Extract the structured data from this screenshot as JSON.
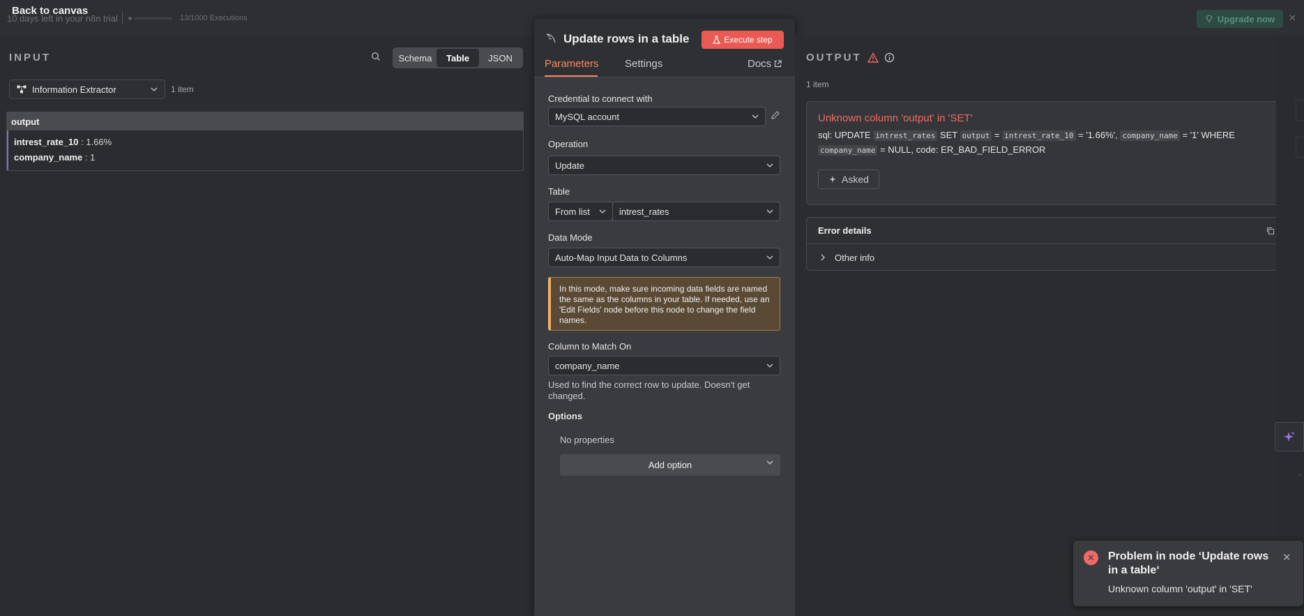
{
  "topbar": {
    "back_label": "Back to canvas",
    "trial_text": "10 days left in your n8n trial",
    "executions_text": "13/1000 Executions",
    "executions_progress": 0.013,
    "upgrade_label": "Upgrade now"
  },
  "input": {
    "title": "INPUT",
    "view_tabs": [
      "Schema",
      "Table",
      "JSON"
    ],
    "active_view": "Table",
    "node_selected": "Information Extractor",
    "items_count": "1 item",
    "table_header": "output",
    "rows": [
      {
        "key": "intrest_rate_10",
        "value": " : 1.66%"
      },
      {
        "key": "company_name",
        "value": " : 1"
      }
    ]
  },
  "node": {
    "title": "Update rows in a table",
    "execute_label": "Execute step",
    "tabs": {
      "parameters": "Parameters",
      "settings": "Settings",
      "docs": "Docs"
    },
    "credential_label": "Credential to connect with",
    "credential_value": "MySQL account",
    "operation_label": "Operation",
    "operation_value": "Update",
    "table_label": "Table",
    "table_mode": "From list",
    "table_value": "intrest_rates",
    "data_mode_label": "Data Mode",
    "data_mode_value": "Auto-Map Input Data to Columns",
    "notice": "In this mode, make sure incoming data fields are named the same as the columns in your table. If needed, use an 'Edit Fields' node before this node to change the field names.",
    "match_label": "Column to Match On",
    "match_value": "company_name",
    "match_hint": "Used to find the correct row to update. Doesn't get changed.",
    "options_label": "Options",
    "no_properties": "No properties",
    "add_option": "Add option"
  },
  "output": {
    "title": "OUTPUT",
    "items_count": "1 item",
    "error_title": "Unknown column 'output' in 'SET'",
    "error_parts": {
      "p1": "sql: UPDATE ",
      "c1": "intrest_rates",
      "p2": " SET ",
      "c2": "output",
      "p3": " = ",
      "c3": "intrest_rate_10",
      "p4": " = '1.66%', ",
      "c4": "company_name",
      "p5": " = '1' WHERE ",
      "c5": "company_name",
      "p6": " = NULL, code: ER_BAD_FIELD_ERROR"
    },
    "asked_label": "Asked",
    "details_title": "Error details",
    "other_info": "Other info"
  },
  "toast": {
    "title": "Problem in node ‘Update rows in a table‘",
    "message": "Unknown column 'output' in 'SET'"
  },
  "colors": {
    "accent": "#f58a62",
    "error": "#f06a66",
    "execute": "#ea5a54"
  }
}
